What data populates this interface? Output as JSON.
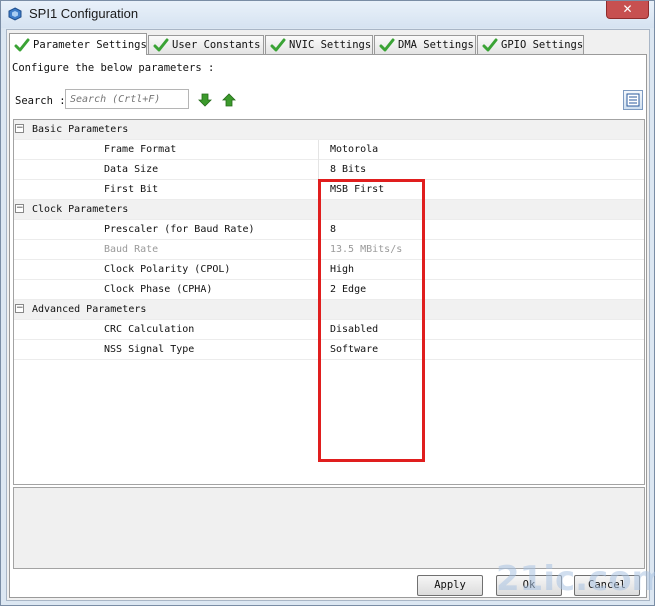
{
  "window": {
    "title": "SPI1 Configuration",
    "close_label": "✕"
  },
  "tabs": [
    {
      "label": "Parameter Settings",
      "active": true
    },
    {
      "label": "User Constants",
      "active": false
    },
    {
      "label": "NVIC Settings",
      "active": false
    },
    {
      "label": "DMA Settings",
      "active": false
    },
    {
      "label": "GPIO Settings",
      "active": false
    }
  ],
  "configure_text": "Configure the below parameters :",
  "search": {
    "label": "Search :",
    "placeholder": "Search (Crtl+F)"
  },
  "groups": [
    {
      "label": "Basic Parameters",
      "toggle": "−",
      "rows": [
        {
          "name": "Frame Format",
          "value": "Motorola",
          "disabled": false
        },
        {
          "name": "Data Size",
          "value": "8 Bits",
          "disabled": false
        },
        {
          "name": "First Bit",
          "value": "MSB First",
          "disabled": false
        }
      ]
    },
    {
      "label": "Clock Parameters",
      "toggle": "−",
      "rows": [
        {
          "name": "Prescaler (for Baud Rate)",
          "value": "8",
          "disabled": false
        },
        {
          "name": "Baud Rate",
          "value": "13.5 MBits/s",
          "disabled": true
        },
        {
          "name": "Clock Polarity (CPOL)",
          "value": "High",
          "disabled": false
        },
        {
          "name": "Clock Phase (CPHA)",
          "value": "2 Edge",
          "disabled": false
        }
      ]
    },
    {
      "label": "Advanced Parameters",
      "toggle": "−",
      "rows": [
        {
          "name": "CRC Calculation",
          "value": "Disabled",
          "disabled": false
        },
        {
          "name": "NSS Signal Type",
          "value": "Software",
          "disabled": false
        }
      ]
    }
  ],
  "buttons": {
    "apply": "Apply",
    "ok": "Ok",
    "cancel": "Cancel"
  },
  "watermark": "21ic.com",
  "colors": {
    "highlight": "#e01e1e",
    "check_green": "#3aa335",
    "arrow_green": "#3c9a2c"
  }
}
